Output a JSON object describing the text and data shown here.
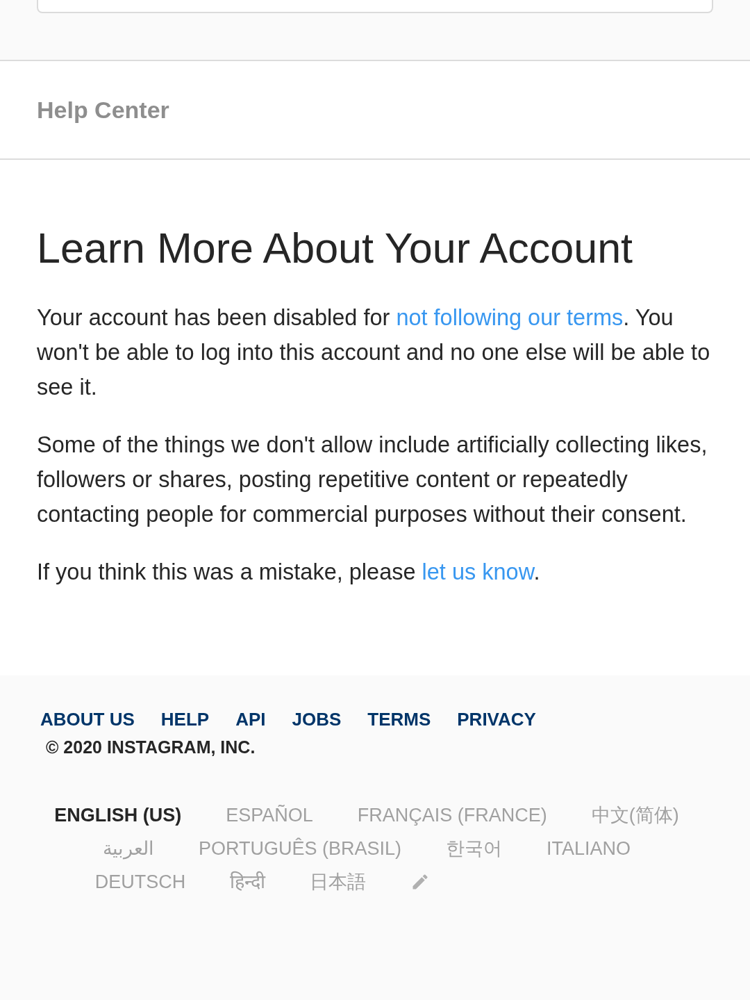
{
  "header": {
    "title": "Help Center"
  },
  "article": {
    "title": "Learn More About Your Account",
    "paragraphs": [
      {
        "parts": [
          {
            "text": "Your account has been disabled for ",
            "kind": "text"
          },
          {
            "text": "not following our terms",
            "kind": "link"
          },
          {
            "text": ". You won't be able to log into this account and no one else will be able to see it.",
            "kind": "text"
          }
        ]
      },
      {
        "parts": [
          {
            "text": "Some of the things we don't allow include artificially collecting likes, followers or shares, posting repetitive content or repeatedly contacting people for commercial purposes without their consent.",
            "kind": "text"
          }
        ]
      },
      {
        "parts": [
          {
            "text": "If you think this was a mistake, please ",
            "kind": "text"
          },
          {
            "text": "let us know",
            "kind": "link"
          },
          {
            "text": ".",
            "kind": "text"
          }
        ]
      }
    ]
  },
  "footer": {
    "links": [
      "ABOUT US",
      "HELP",
      "API",
      "JOBS",
      "TERMS",
      "PRIVACY"
    ],
    "copyright": "© 2020 INSTAGRAM, INC.",
    "languages": [
      {
        "label": "ENGLISH (US)",
        "selected": true
      },
      {
        "label": "ESPAÑOL",
        "selected": false
      },
      {
        "label": "FRANÇAIS (FRANCE)",
        "selected": false
      },
      {
        "label": "中文(简体)",
        "selected": false
      },
      {
        "label": "العربية",
        "selected": false
      },
      {
        "label": "PORTUGUÊS (BRASIL)",
        "selected": false
      },
      {
        "label": "한국어",
        "selected": false
      },
      {
        "label": "ITALIANO",
        "selected": false
      },
      {
        "label": "DEUTSCH",
        "selected": false
      },
      {
        "label": "हिन्दी",
        "selected": false
      },
      {
        "label": "日本語",
        "selected": false
      }
    ]
  }
}
